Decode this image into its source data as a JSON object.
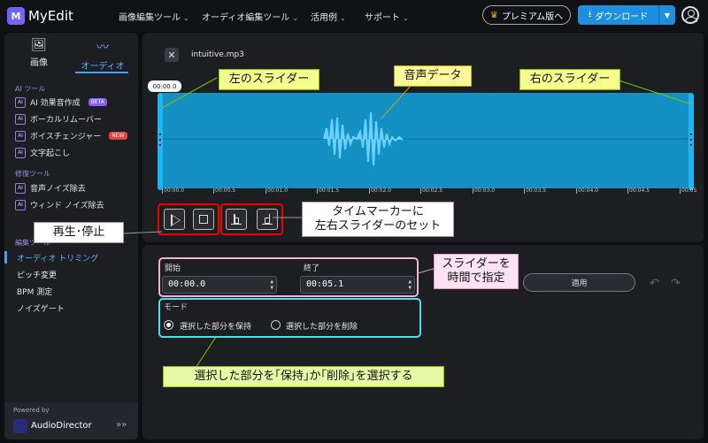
{
  "app": {
    "brand": "MyEdit",
    "logo": "M"
  },
  "nav": [
    "画像編集ツール",
    "オーディオ編集ツール",
    "活用例",
    "サポート"
  ],
  "header": {
    "premium": "プレミアム版へ",
    "download": "ダウンロード"
  },
  "sidebar": {
    "tabs": [
      {
        "label": "画像"
      },
      {
        "label": "オーディオ"
      }
    ],
    "sections": [
      "AI ツール",
      "修復ツール",
      "編集ツール"
    ],
    "ai_items": [
      {
        "label": "AI 効果音作成",
        "badge": "BETA"
      },
      {
        "label": "ボーカルリムーバー",
        "badge": ""
      },
      {
        "label": "ボイスチェンジャー",
        "badge": "NEW"
      },
      {
        "label": "文字起こし",
        "badge": ""
      }
    ],
    "repair_items": [
      {
        "label": "音声ノイズ除去"
      },
      {
        "label": "ウィンド ノイズ除去"
      }
    ],
    "edit_items": [
      {
        "label": "オーディオ トリミング"
      },
      {
        "label": "ピッチ変更"
      },
      {
        "label": "BPM 測定"
      },
      {
        "label": "ノイズゲート"
      }
    ],
    "powered_by": "Powered by",
    "powered_name": "AudioDirector"
  },
  "editor": {
    "filename": "intuitive.mp3",
    "time_bubble": "00:00.0",
    "ruler": [
      "00:00.0",
      "00:00.5",
      "00:01.0",
      "00:01.5",
      "00:02.0",
      "00:02.5",
      "00:03.0",
      "00:03.5",
      "00:04.0",
      "00:04.5",
      "00:05"
    ],
    "start_label": "開始",
    "start_value": "00:00.0",
    "end_label": "終了",
    "end_value": "00:05.1",
    "apply": "適用",
    "mode_label": "モード",
    "mode_options": [
      {
        "label": "選択した部分を保持",
        "selected": true
      },
      {
        "label": "選択した部分を削除",
        "selected": false
      }
    ]
  },
  "callouts": {
    "left_slider": "左のスライダー",
    "audio_data": "音声データ",
    "right_slider": "右のスライダー",
    "play_stop": "再生･停止",
    "time_marker_line1": "タイムマーカーに",
    "time_marker_line2": "左右スライダーのセット",
    "slider_time_line1": "スライダーを",
    "slider_time_line2": "時間で指定",
    "keep_delete": "選択した部分を｢保持｣か｢削除｣を選択する"
  },
  "colors": {
    "accent": "#1e8fdf",
    "waveform": "#1390c4",
    "annotation_red": "#ee0000",
    "annotation_pink": "#efb3d7",
    "annotation_cyan": "#4ae0e8"
  }
}
